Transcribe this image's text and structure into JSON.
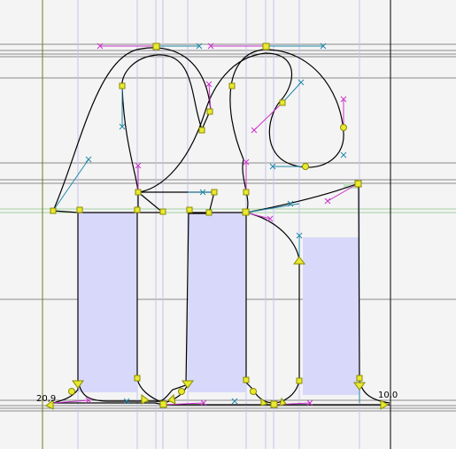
{
  "colors": {
    "background": "#f4f4f4",
    "fill": "#d8d8fa",
    "outline": "#000000",
    "guide": "#8a8a8a",
    "vguide": "#c4c4ee",
    "metric_line": "#6b7a1e",
    "handle_magenta": "#cc33cc",
    "handle_cyan": "#2288aa",
    "point_fill": "#e9e930",
    "point_stroke": "#8a8a00"
  },
  "labels": {
    "left_coord": "20,9",
    "right_coord": "10,0"
  }
}
